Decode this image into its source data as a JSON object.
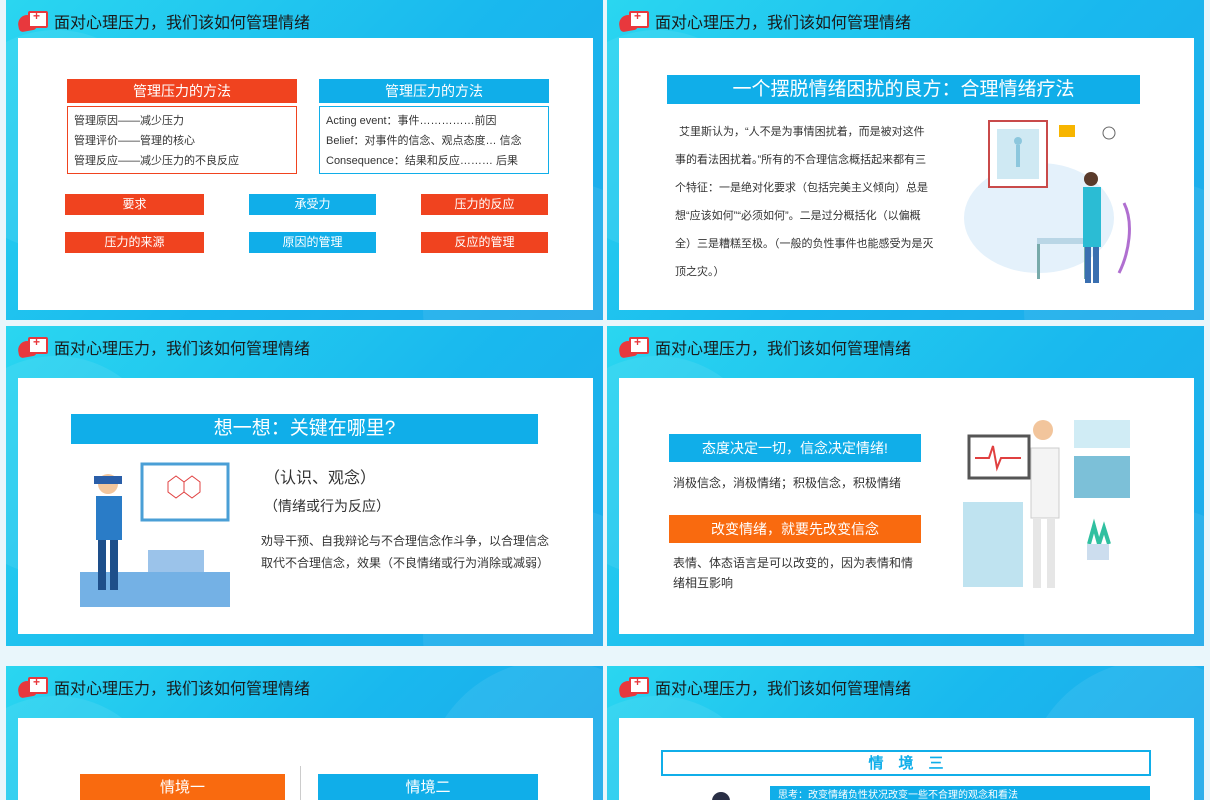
{
  "header_title": "面对心理压力，我们该如何管理情绪",
  "s1": {
    "left_head": "管理压力的方法",
    "left_lines": [
      "管理原因——减少压力",
      "管理评价——管理的核心",
      "管理反应——减少压力的不良反应"
    ],
    "right_head": "管理压力的方法",
    "right_lines": [
      "Acting event：事件……………前因",
      "Belief：对事件的信念、观点态度… 信念",
      "Consequence：结果和反应……… 后果"
    ],
    "row1": [
      "要求",
      "承受力",
      "压力的反应"
    ],
    "row2": [
      "压力的来源",
      "原因的管理",
      "反应的管理"
    ]
  },
  "s2": {
    "title": "一个摆脱情绪困扰的良方：合理情绪疗法",
    "body": "艾里斯认为，“人不是为事情困扰着，而是被对这件事的看法困扰着。”所有的不合理信念概括起来都有三个特征：一是绝对化要求（包括完美主义倾向）总是想“应该如何”“必须如何”。二是过分概括化（以偏概全）三是糟糕至极。（一般的负性事件也能感受为是灭顶之灾。）"
  },
  "s3": {
    "title": "想一想：关键在哪里?",
    "line1": "（认识、观念）",
    "line2": "（情绪或行为反应）",
    "body": "劝导干预、自我辩论与不合理信念作斗争，以合理信念取代不合理信念，效果（不良情绪或行为消除或减弱）"
  },
  "s4": {
    "head1": "态度决定一切，信念决定情绪!",
    "text1": "消极信念，消极情绪；积极信念，积极情绪",
    "head2": "改变情绪，就要先改变信念",
    "text2": "表情、体态语言是可以改变的，因为表情和情绪相互影响"
  },
  "s5": {
    "tag1": "情境一",
    "tag2": "情境二"
  },
  "s6": {
    "title": "情　境　三",
    "sub": "思考：改变情绪负性状况改变一些不合理的观念和看法"
  },
  "colors": {
    "red": "#f0431f",
    "blue": "#10aee9",
    "orange": "#f96a0f",
    "bg": "#19b8ee"
  }
}
